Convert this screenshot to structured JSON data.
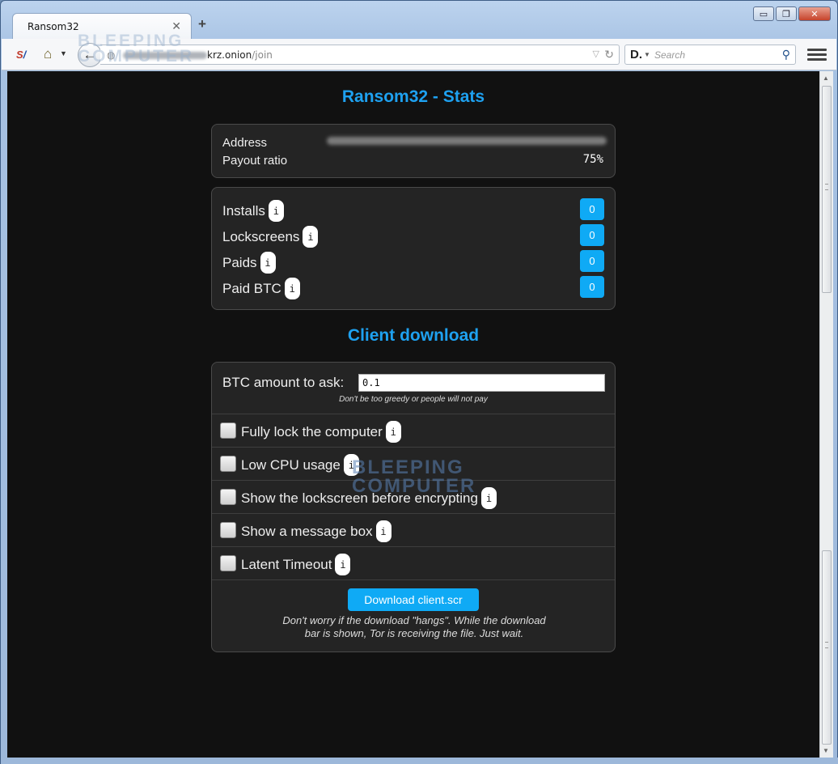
{
  "browser": {
    "tab_title": "Ransom32",
    "tab_close": "✕",
    "new_tab": "+",
    "window_buttons": {
      "minimize": "▭",
      "restore": "❐",
      "close": "✕"
    },
    "url_host": "krz.onion",
    "url_path": "/join",
    "search_placeholder": "Search",
    "watermark": "BLEEPING COMPUTER"
  },
  "page": {
    "stats_title": "Ransom32 - Stats",
    "address_label": "Address",
    "payout_label": "Payout ratio",
    "payout_value": "75%",
    "stats": [
      {
        "label": "Installs",
        "info": "i",
        "count": "0"
      },
      {
        "label": "Lockscreens",
        "info": "i",
        "count": "0"
      },
      {
        "label": "Paids",
        "info": "i",
        "count": "0"
      },
      {
        "label": "Paid BTC",
        "info": "i",
        "count": "0"
      }
    ],
    "client_title": "Client download",
    "btc_label": "BTC amount to ask:",
    "btc_value": "0.1",
    "btc_hint": "Don't be too greedy or people will not pay",
    "options": [
      {
        "label": "Fully lock the computer",
        "info": "i",
        "checked": false
      },
      {
        "label": "Low CPU usage",
        "info": "i",
        "checked": false
      },
      {
        "label": "Show the lockscreen before encrypting",
        "info": "i",
        "checked": false
      },
      {
        "label": "Show a message box",
        "info": "i",
        "checked": false
      },
      {
        "label": "Latent Timeout",
        "info": "i",
        "checked": false
      }
    ],
    "download_button": "Download client.scr",
    "download_note_1": "Don't worry if the download \"hangs\". While the download",
    "download_note_2": "bar is shown, Tor is receiving the file. Just wait."
  },
  "colors": {
    "accent": "#1ea1f0",
    "badge": "#0faaf5",
    "panel": "#242424",
    "page_bg": "#111111"
  }
}
